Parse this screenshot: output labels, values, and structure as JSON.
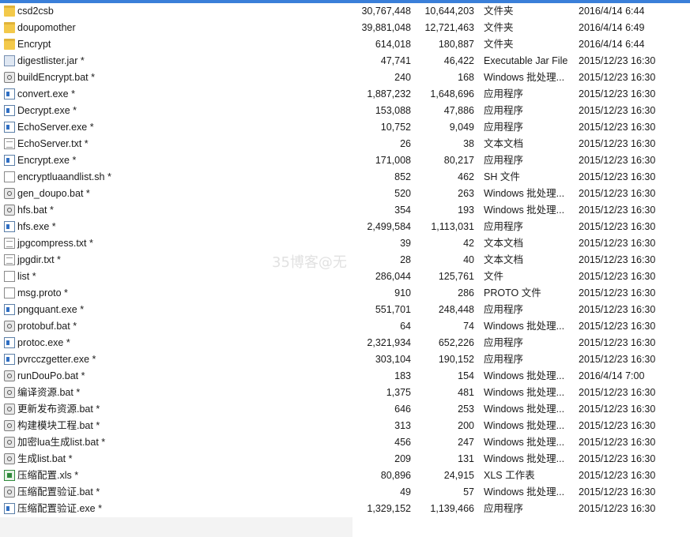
{
  "colors": {
    "accent": "#3a7fd9",
    "folder": "#f3c94a"
  },
  "files": [
    {
      "name": "csd2csb",
      "size": "30,767,448",
      "packed": "10,644,203",
      "type": "文件夹",
      "date": "2016/4/14 6:44",
      "icon": "folder-icon"
    },
    {
      "name": "doupomother",
      "size": "39,881,048",
      "packed": "12,721,463",
      "type": "文件夹",
      "date": "2016/4/14 6:49",
      "icon": "folder-icon"
    },
    {
      "name": "Encrypt",
      "size": "614,018",
      "packed": "180,887",
      "type": "文件夹",
      "date": "2016/4/14 6:44",
      "icon": "folder-icon"
    },
    {
      "name": "digestlister.jar *",
      "size": "47,741",
      "packed": "46,422",
      "type": "Executable Jar File",
      "date": "2015/12/23 16:30",
      "icon": "jar-file-icon"
    },
    {
      "name": "buildEncrypt.bat *",
      "size": "240",
      "packed": "168",
      "type": "Windows 批处理...",
      "date": "2015/12/23 16:30",
      "icon": "batch-file-icon"
    },
    {
      "name": "convert.exe *",
      "size": "1,887,232",
      "packed": "1,648,696",
      "type": "应用程序",
      "date": "2015/12/23 16:30",
      "icon": "exe-file-icon"
    },
    {
      "name": "Decrypt.exe *",
      "size": "153,088",
      "packed": "47,886",
      "type": "应用程序",
      "date": "2015/12/23 16:30",
      "icon": "exe-file-icon"
    },
    {
      "name": "EchoServer.exe *",
      "size": "10,752",
      "packed": "9,049",
      "type": "应用程序",
      "date": "2015/12/23 16:30",
      "icon": "exe-file-icon"
    },
    {
      "name": "EchoServer.txt *",
      "size": "26",
      "packed": "38",
      "type": "文本文档",
      "date": "2015/12/23 16:30",
      "icon": "text-file-icon"
    },
    {
      "name": "Encrypt.exe *",
      "size": "171,008",
      "packed": "80,217",
      "type": "应用程序",
      "date": "2015/12/23 16:30",
      "icon": "exe-file-icon"
    },
    {
      "name": "encryptluaandlist.sh *",
      "size": "852",
      "packed": "462",
      "type": "SH 文件",
      "date": "2015/12/23 16:30",
      "icon": "generic-file-icon"
    },
    {
      "name": "gen_doupo.bat *",
      "size": "520",
      "packed": "263",
      "type": "Windows 批处理...",
      "date": "2015/12/23 16:30",
      "icon": "batch-file-icon"
    },
    {
      "name": "hfs.bat *",
      "size": "354",
      "packed": "193",
      "type": "Windows 批处理...",
      "date": "2015/12/23 16:30",
      "icon": "batch-file-icon"
    },
    {
      "name": "hfs.exe *",
      "size": "2,499,584",
      "packed": "1,113,031",
      "type": "应用程序",
      "date": "2015/12/23 16:30",
      "icon": "exe-file-icon"
    },
    {
      "name": "jpgcompress.txt *",
      "size": "39",
      "packed": "42",
      "type": "文本文档",
      "date": "2015/12/23 16:30",
      "icon": "text-file-icon"
    },
    {
      "name": "jpgdir.txt *",
      "size": "28",
      "packed": "40",
      "type": "文本文档",
      "date": "2015/12/23 16:30",
      "icon": "text-file-icon"
    },
    {
      "name": "list *",
      "size": "286,044",
      "packed": "125,761",
      "type": "文件",
      "date": "2015/12/23 16:30",
      "icon": "generic-file-icon"
    },
    {
      "name": "msg.proto *",
      "size": "910",
      "packed": "286",
      "type": "PROTO 文件",
      "date": "2015/12/23 16:30",
      "icon": "generic-file-icon"
    },
    {
      "name": "pngquant.exe *",
      "size": "551,701",
      "packed": "248,448",
      "type": "应用程序",
      "date": "2015/12/23 16:30",
      "icon": "exe-file-icon"
    },
    {
      "name": "protobuf.bat *",
      "size": "64",
      "packed": "74",
      "type": "Windows 批处理...",
      "date": "2015/12/23 16:30",
      "icon": "batch-file-icon"
    },
    {
      "name": "protoc.exe *",
      "size": "2,321,934",
      "packed": "652,226",
      "type": "应用程序",
      "date": "2015/12/23 16:30",
      "icon": "exe-file-icon"
    },
    {
      "name": "pvrcczgetter.exe *",
      "size": "303,104",
      "packed": "190,152",
      "type": "应用程序",
      "date": "2015/12/23 16:30",
      "icon": "exe-file-icon"
    },
    {
      "name": "runDouPo.bat *",
      "size": "183",
      "packed": "154",
      "type": "Windows 批处理...",
      "date": "2016/4/14 7:00",
      "icon": "batch-file-icon"
    },
    {
      "name": "编译资源.bat *",
      "size": "1,375",
      "packed": "481",
      "type": "Windows 批处理...",
      "date": "2015/12/23 16:30",
      "icon": "batch-file-icon"
    },
    {
      "name": "更新发布资源.bat *",
      "size": "646",
      "packed": "253",
      "type": "Windows 批处理...",
      "date": "2015/12/23 16:30",
      "icon": "batch-file-icon"
    },
    {
      "name": "构建模块工程.bat *",
      "size": "313",
      "packed": "200",
      "type": "Windows 批处理...",
      "date": "2015/12/23 16:30",
      "icon": "batch-file-icon"
    },
    {
      "name": "加密lua生成list.bat *",
      "size": "456",
      "packed": "247",
      "type": "Windows 批处理...",
      "date": "2015/12/23 16:30",
      "icon": "batch-file-icon"
    },
    {
      "name": "生成list.bat *",
      "size": "209",
      "packed": "131",
      "type": "Windows 批处理...",
      "date": "2015/12/23 16:30",
      "icon": "batch-file-icon"
    },
    {
      "name": "压缩配置.xls *",
      "size": "80,896",
      "packed": "24,915",
      "type": "XLS 工作表",
      "date": "2015/12/23 16:30",
      "icon": "spreadsheet-file-icon"
    },
    {
      "name": "压缩配置验证.bat *",
      "size": "49",
      "packed": "57",
      "type": "Windows 批处理...",
      "date": "2015/12/23 16:30",
      "icon": "batch-file-icon"
    },
    {
      "name": "压缩配置验证.exe *",
      "size": "1,329,152",
      "packed": "1,139,466",
      "type": "应用程序",
      "date": "2015/12/23 16:30",
      "icon": "exe-file-icon"
    }
  ],
  "watermark": "35博客@无"
}
